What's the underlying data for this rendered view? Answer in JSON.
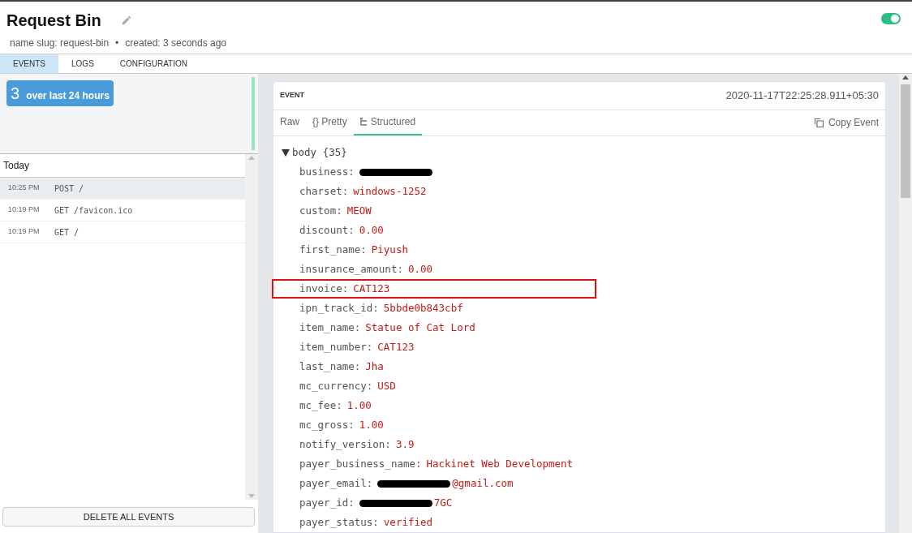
{
  "header": {
    "title": "Request Bin",
    "slug_label": "name slug: request-bin",
    "separator": "•",
    "created": "created: 3 seconds ago",
    "active": true
  },
  "tabs": [
    {
      "label": "EVENTS",
      "selected": true
    },
    {
      "label": "LOGS",
      "selected": false
    },
    {
      "label": "CONFIGURATION",
      "selected": false
    }
  ],
  "summary": {
    "count": "3",
    "label": "over last 24 hours"
  },
  "event_list": {
    "group": "Today",
    "items": [
      {
        "time": "10:25 PM",
        "request": "POST /",
        "selected": true
      },
      {
        "time": "10:19 PM",
        "request": "GET /favicon.ico",
        "selected": false
      },
      {
        "time": "10:19 PM",
        "request": "GET /",
        "selected": false
      }
    ]
  },
  "delete_button": "DELETE ALL EVENTS",
  "event": {
    "heading": "EVENT",
    "timestamp": "2020-11-17T22:25:28.911+05:30",
    "view_tabs": [
      {
        "label": "Raw",
        "selected": false
      },
      {
        "label": "{} Pretty",
        "selected": false
      },
      {
        "label": "Structured",
        "selected": true
      }
    ],
    "copy_button": "Copy Event",
    "root": {
      "label": "body {35}",
      "expanded": true
    },
    "fields": [
      {
        "key": "business:",
        "redacted": true
      },
      {
        "key": "charset:",
        "value": "windows-1252"
      },
      {
        "key": "custom:",
        "value": "MEOW"
      },
      {
        "key": "discount:",
        "value": "0.00"
      },
      {
        "key": "first_name:",
        "value": "Piyush"
      },
      {
        "key": "insurance_amount:",
        "value": "0.00"
      },
      {
        "key": "invoice:",
        "value": "CAT123",
        "highlighted": true
      },
      {
        "key": "ipn_track_id:",
        "value": "5bbde0b843cbf"
      },
      {
        "key": "item_name:",
        "value": "Statue of Cat Lord"
      },
      {
        "key": "item_number:",
        "value": "CAT123"
      },
      {
        "key": "last_name:",
        "value": "Jha"
      },
      {
        "key": "mc_currency:",
        "value": "USD"
      },
      {
        "key": "mc_fee:",
        "value": "1.00"
      },
      {
        "key": "mc_gross:",
        "value": "1.00"
      },
      {
        "key": "notify_version:",
        "value": "3.9"
      },
      {
        "key": "payer_business_name:",
        "value": "Hackinet Web Development"
      },
      {
        "key": "payer_email:",
        "value": "@gmail.com",
        "redacted": true
      },
      {
        "key": "payer_id:",
        "value": "7GC",
        "redacted": true
      },
      {
        "key": "payer_status:",
        "value": "verified"
      }
    ]
  }
}
